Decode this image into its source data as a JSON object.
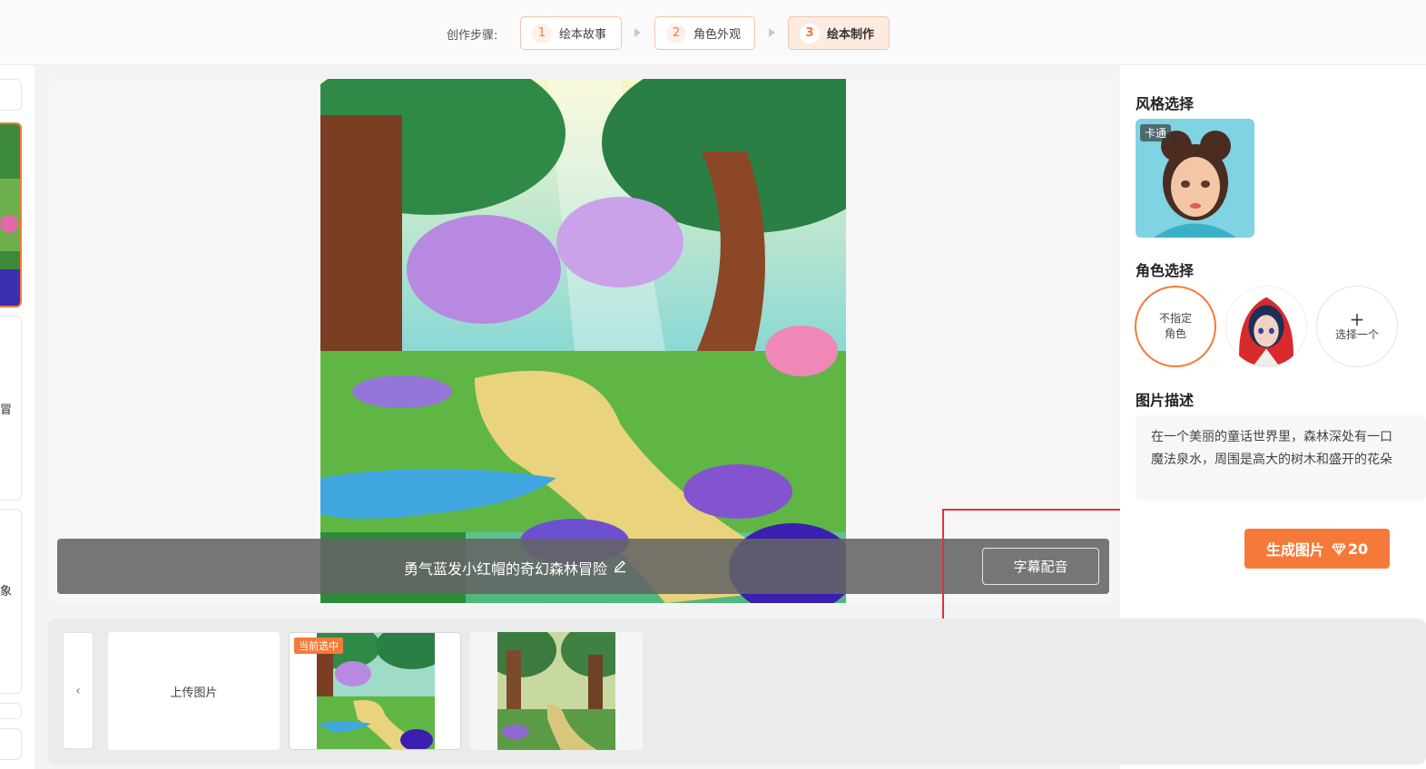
{
  "header": {
    "steps_label": "创作步骤:",
    "steps": [
      {
        "num": "1",
        "label": "绘本故事"
      },
      {
        "num": "2",
        "label": "角色外观"
      },
      {
        "num": "3",
        "label": "绘本制作"
      }
    ],
    "active_step": 3
  },
  "left_strip": {
    "chars": [
      "冒",
      "象"
    ]
  },
  "canvas": {
    "caption": "勇气蓝发小红帽的奇幻森林冒险",
    "subtitle_button": "字幕配音"
  },
  "panel": {
    "style_title": "风格选择",
    "style_tag": "卡通",
    "role_title": "角色选择",
    "role_none_line1": "不指定",
    "role_none_line2": "角色",
    "role_add_plus": "+",
    "role_add_label": "选择一个",
    "desc_title": "图片描述",
    "desc_line1": "在一个美丽的童话世界里，森林深处有一口",
    "desc_line2": "魔法泉水，周围是高大的树木和盛开的花朵",
    "generate_label": "生成图片",
    "generate_cost": "20"
  },
  "tray": {
    "prev_icon": "‹",
    "upload_label": "上传图片",
    "current_badge": "当前选中"
  },
  "colors": {
    "accent": "#f57a3a",
    "annotation": "#e53232"
  }
}
